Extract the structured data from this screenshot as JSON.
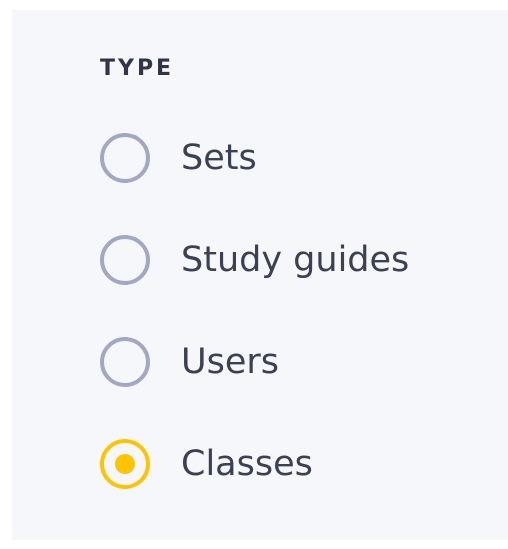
{
  "filter": {
    "section_title": "TYPE",
    "selected": "Classes",
    "options": [
      {
        "label": "Sets",
        "checked": false
      },
      {
        "label": "Study guides",
        "checked": false
      },
      {
        "label": "Users",
        "checked": false
      },
      {
        "label": "Classes",
        "checked": true
      }
    ]
  },
  "colors": {
    "panel_bg": "#f6f7fb",
    "radio_border": "#a3a8c2",
    "radio_selected": "#ffc400",
    "label_text": "#3b4152",
    "title_text": "#303545"
  }
}
